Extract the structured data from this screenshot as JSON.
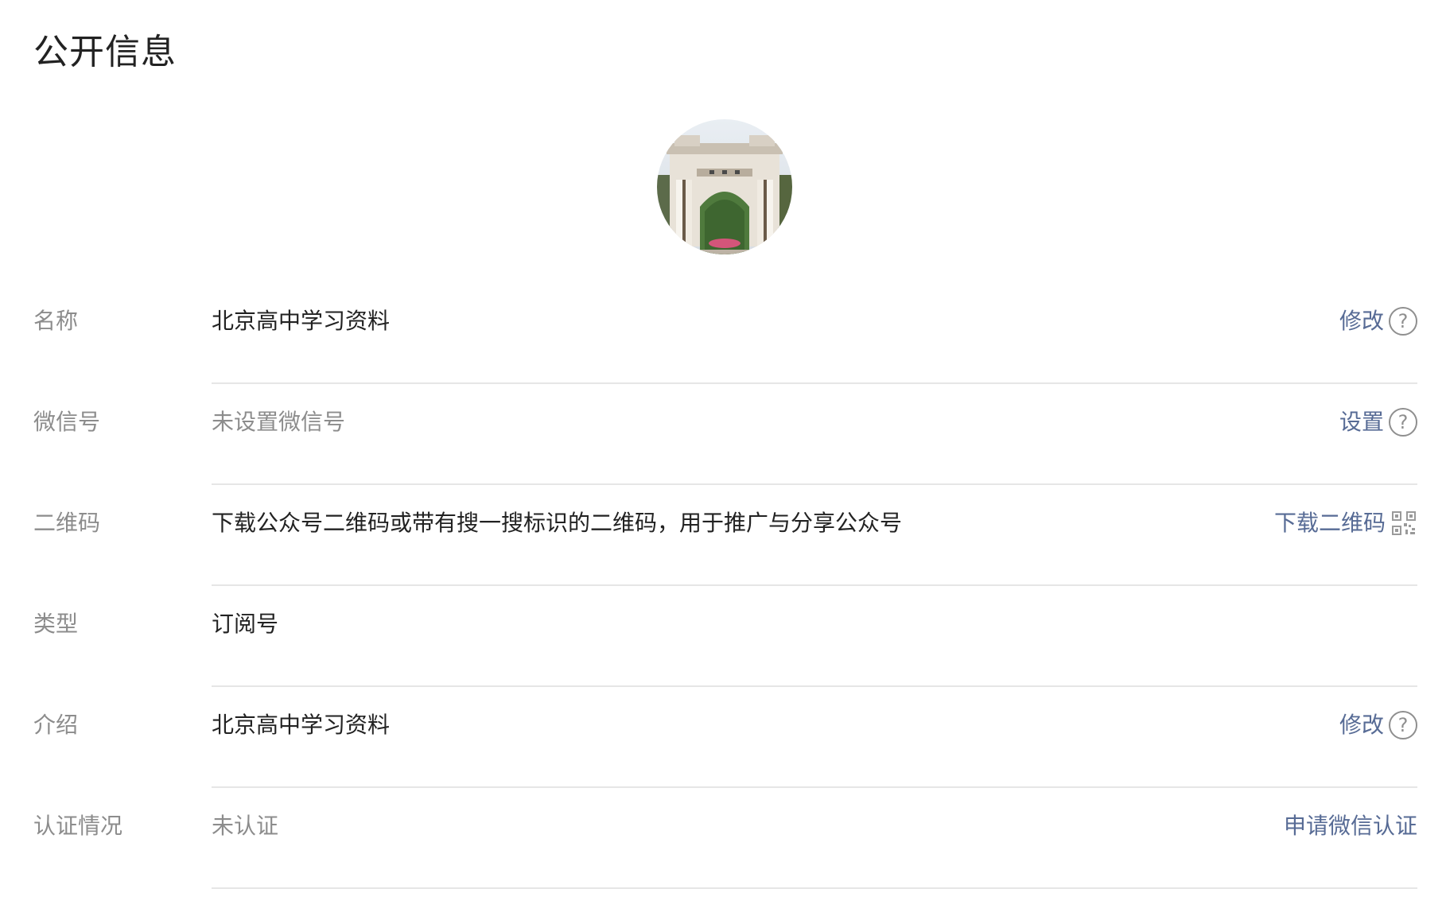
{
  "header": {
    "title": "公开信息"
  },
  "avatar": {
    "icon": "university-gate-avatar"
  },
  "rows": [
    {
      "label": "名称",
      "value": "北京高中学习资料",
      "action": "修改",
      "action_icon": "help-icon"
    },
    {
      "label": "微信号",
      "value": "未设置微信号",
      "action": "设置",
      "action_icon": "help-icon"
    },
    {
      "label": "二维码",
      "value": "下载公众号二维码或带有搜一搜标识的二维码，用于推广与分享公众号",
      "action": "下载二维码",
      "action_icon": "qr-code-icon"
    },
    {
      "label": "类型",
      "value": "订阅号"
    },
    {
      "label": "介绍",
      "value": "北京高中学习资料",
      "action": "修改",
      "action_icon": "help-icon"
    },
    {
      "label": "认证情况",
      "value": "未认证",
      "action": "申请微信认证"
    }
  ],
  "colors": {
    "link": "#576b95",
    "label": "#8c8c8c",
    "text": "#222222",
    "divider": "#e6e6e6"
  }
}
